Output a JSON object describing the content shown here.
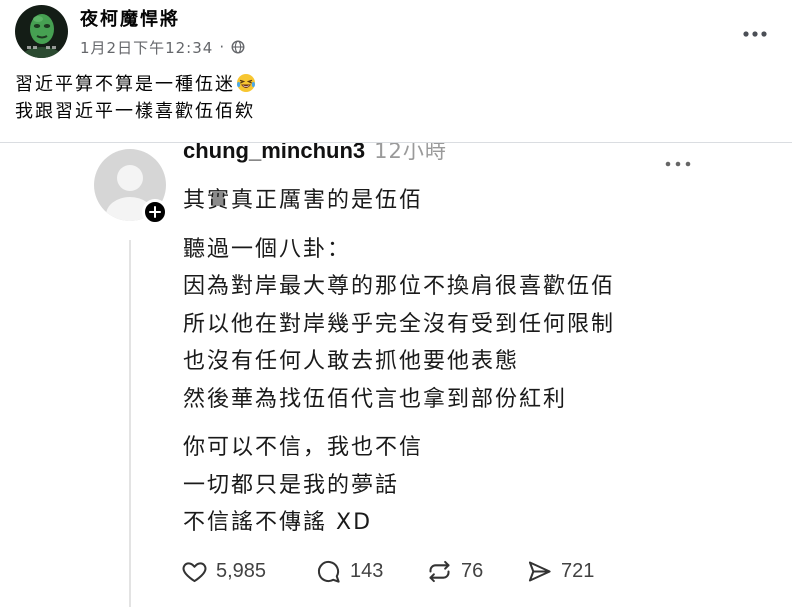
{
  "post": {
    "author_name": "夜柯魔悍將",
    "timestamp": "1月2日下午12:34",
    "separator": "·",
    "audience_icon": "globe-icon",
    "more_icon": "more-options-icon",
    "text_lines": [
      "習近平算不算是一種伍迷",
      "我跟習近平一樣喜歡伍佰欸"
    ],
    "text_line_1_emoji_icon": "face-with-tears-of-joy-icon"
  },
  "embedded_threads_post": {
    "username": "chung_minchun3",
    "time_ago": "12小時",
    "avatar_badge_icon": "plus-icon",
    "more_icon": "more-options-icon",
    "paragraphs": [
      [
        "其實真正厲害的是伍佰"
      ],
      [
        "聽過一個八卦：",
        "因為對岸最大尊的那位不換肩很喜歡伍佰",
        "所以他在對岸幾乎完全沒有受到任何限制",
        "也沒有任何人敢去抓他要他表態",
        "然後華為找伍佰代言也拿到部份紅利"
      ],
      [
        "你可以不信，我也不信",
        "一切都只是我的夢話",
        "不信謠不傳謠 XD"
      ]
    ],
    "actions": [
      {
        "icon": "heart-icon",
        "count": "5,985"
      },
      {
        "icon": "comment-icon",
        "count": "143"
      },
      {
        "icon": "repost-icon",
        "count": "76"
      },
      {
        "icon": "share-icon",
        "count": "721"
      }
    ]
  },
  "colors": {
    "primary_text": "#050505",
    "secondary_text": "#65676b",
    "threads_text": "#1a1a1a",
    "threads_time": "#9a9a9a",
    "thread_line": "#e3e3e3"
  }
}
